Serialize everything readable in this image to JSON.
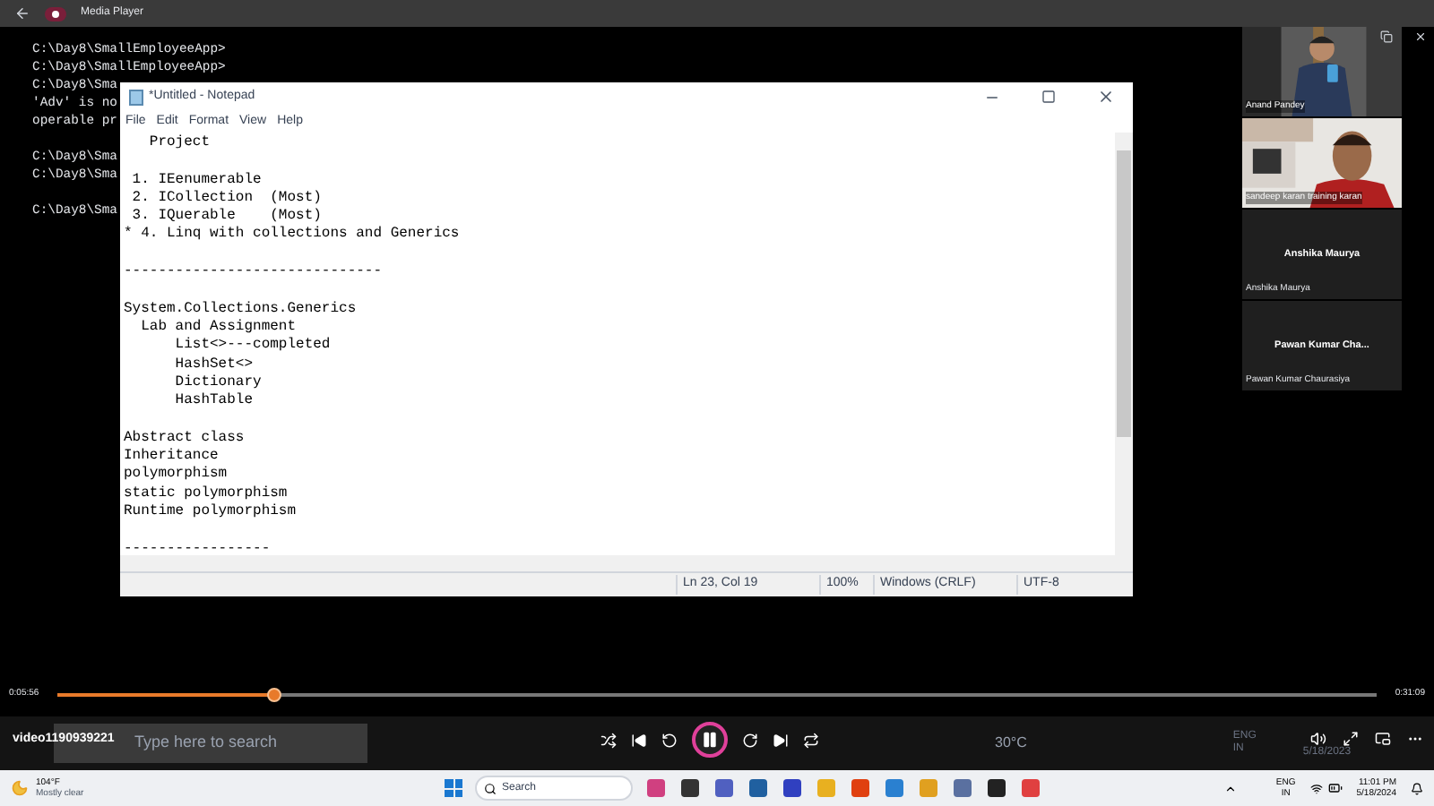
{
  "app": {
    "title": "Media Player"
  },
  "video": {
    "console_groups": [
      [
        "C:\\Day8\\SmallEmployeeApp>",
        "C:\\Day8\\SmallEmployeeApp>",
        "C:\\Day8\\Sma",
        "'Adv' is no",
        "operable pr"
      ],
      [
        "C:\\Day8\\Sma",
        "C:\\Day8\\Sma"
      ],
      [
        "C:\\Day8\\Sma"
      ]
    ],
    "notepad": {
      "title": "*Untitled - Notepad",
      "menu": [
        "File",
        "Edit",
        "Format",
        "View",
        "Help"
      ],
      "text_groups": [
        [
          "   Project"
        ],
        [
          " 1. IEenumerable",
          " 2. ICollection  (Most)",
          " 3. IQuerable    (Most)",
          "* 4. Linq with collections and Generics"
        ],
        [
          "------------------------------"
        ],
        [
          "System.Collections.Generics",
          "  Lab and Assignment",
          "      List<>---completed",
          "      HashSet<>",
          "      Dictionary",
          "      HashTable"
        ],
        [
          "Abstract class",
          "Inheritance",
          "polymorphism",
          "static polymorphism",
          "Runtime polymorphism"
        ],
        [
          "-----------------"
        ]
      ],
      "status": {
        "position": "Ln 23, Col 19",
        "zoom": "100%",
        "line_ending": "Windows (CRLF)",
        "encoding": "UTF-8"
      }
    },
    "participants": [
      {
        "kind": "video",
        "name": "Anand Pandey"
      },
      {
        "kind": "video",
        "name": "sandeep karan training karan"
      },
      {
        "kind": "avatar",
        "tile_label": "Anshika Maurya",
        "name": "Anshika Maurya"
      },
      {
        "kind": "avatar",
        "tile_label": "Pawan Kumar Cha...",
        "name": "Pawan Kumar Chaurasiya"
      }
    ],
    "taskbar": {
      "search_hint": "Type here to search",
      "temperature": "30°C",
      "language": "ENG",
      "region": "IN",
      "date": "5/18/2023"
    }
  },
  "player": {
    "elapsed": "0:05:56",
    "total": "0:31:09",
    "level": 0.165,
    "file_name": "video1190939221",
    "playing": true
  },
  "taskbar": {
    "weather": {
      "temp": "104°F",
      "condition": "Mostly clear"
    },
    "search_label": "Search",
    "language": "ENG",
    "region": "IN",
    "time": "11:01 PM",
    "date": "5/18/2024"
  }
}
